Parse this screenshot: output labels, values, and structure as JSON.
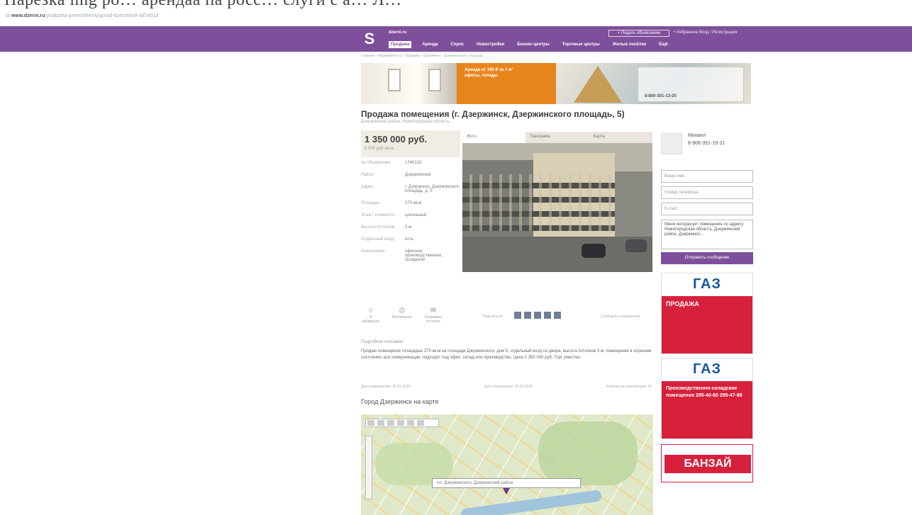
{
  "top_strip": {
    "text": "Нарезка img ро… арендаа па росс… слуги с а… Л…"
  },
  "browser": {
    "url_domain": "www.dzerni.ru",
    "url_path": "/prodazha-pomeshheniy/gorod-dzerzhinsk-id/14013"
  },
  "header": {
    "logo_glyph": "S",
    "site_name": "dzerni.ru",
    "tagline": "",
    "add_button": "+ Подать объявление",
    "top_links": "• Избранное   Вход / Регистрация",
    "menu": [
      "Продажа",
      "Аренда",
      "Спрос",
      "Новостройки",
      "Бизнес-центры",
      "Торговые центры",
      "Жилые посёлки",
      "Ещё"
    ]
  },
  "breadcrumbs": "Главная › Недвижимость › Продажа › Дзержинск › Дзержинского площадь",
  "banner": {
    "promo_text": "Аренда от 300 ₽ за 1 м² офисы, склады",
    "phone": "8-800-301-13-20"
  },
  "listing": {
    "title": "Продажа помещения (г. Дзержинск, Дзержинского площадь, 5)",
    "subtitle": "Дзержинский район, Нижегородская область",
    "price": "1 350 000 руб.",
    "price_per_sqm": "5 000 руб./кв.м",
    "properties": [
      {
        "label": "№ объявления:",
        "value": "1740133"
      },
      {
        "label": "Район:",
        "value": "Дзержинский"
      },
      {
        "label": "Адрес:",
        "value": "г. Дзержинск, Дзержинского площадь, д. 5"
      },
      {
        "label": "Площадь:",
        "value": "270 кв.м"
      },
      {
        "label": "Этаж / этажность:",
        "value": "цокольный"
      },
      {
        "label": "Высота потолков:",
        "value": "3 м"
      },
      {
        "label": "Отдельный вход:",
        "value": "есть"
      },
      {
        "label": "Назначение:",
        "value": "офисное, производственное, складское"
      }
    ],
    "tabs": [
      "Фото",
      "Панорама",
      "Карта"
    ],
    "actions": [
      {
        "icon": "☆",
        "label": "В избранное"
      },
      {
        "icon": "⎙",
        "label": "Распечатать"
      },
      {
        "icon": "✉",
        "label": "Отправить по почте"
      }
    ],
    "share_label": "Поделиться:",
    "complain_label": "Сообщить о нарушении",
    "description_heading": "Подробное описание:",
    "description": "Продаю помещение площадью 270 кв.м на площади Дзержинского, дом 5, отдельный вход со двора, высота потолков 3 м, помещение в хорошем состоянии, все коммуникации, подходит под офис, склад или производство. Цена 1 350 000 руб. Торг уместен.",
    "meta": {
      "created": "Дата размещения: 20.02.2014",
      "updated": "Дата обновления: 20.03.2014",
      "views": "Количество просмотров: 91"
    }
  },
  "map": {
    "heading": "Город Дзержинск на карте",
    "search_text": "пл. Дзержинского, Дзержинский район"
  },
  "sidebar": {
    "agent_name": "Михаил",
    "agent_phone": "8-906-351-19-21",
    "form": {
      "name_placeholder": "Ваше имя",
      "phone_placeholder": "Номер телефона",
      "email_placeholder": "E-mail",
      "message": "Меня интересует помещение по адресу Нижегородская область, Дзержинский район, Дзержинск..."
    },
    "send_button": "Отправить сообщение",
    "ads": [
      {
        "logo": "ГАЗ",
        "text": "ПРОДАЖА"
      },
      {
        "logo": "ГАЗ",
        "text": "Производственно-складские помещения 295-40-60 295-47-88"
      },
      {
        "text": "БАНЗАЙ"
      }
    ]
  },
  "colors": {
    "brand": "#7e4f9a",
    "ad_red": "#d6203c",
    "gaz_blue": "#1a5a9e",
    "banner_orange": "#e7851d"
  }
}
